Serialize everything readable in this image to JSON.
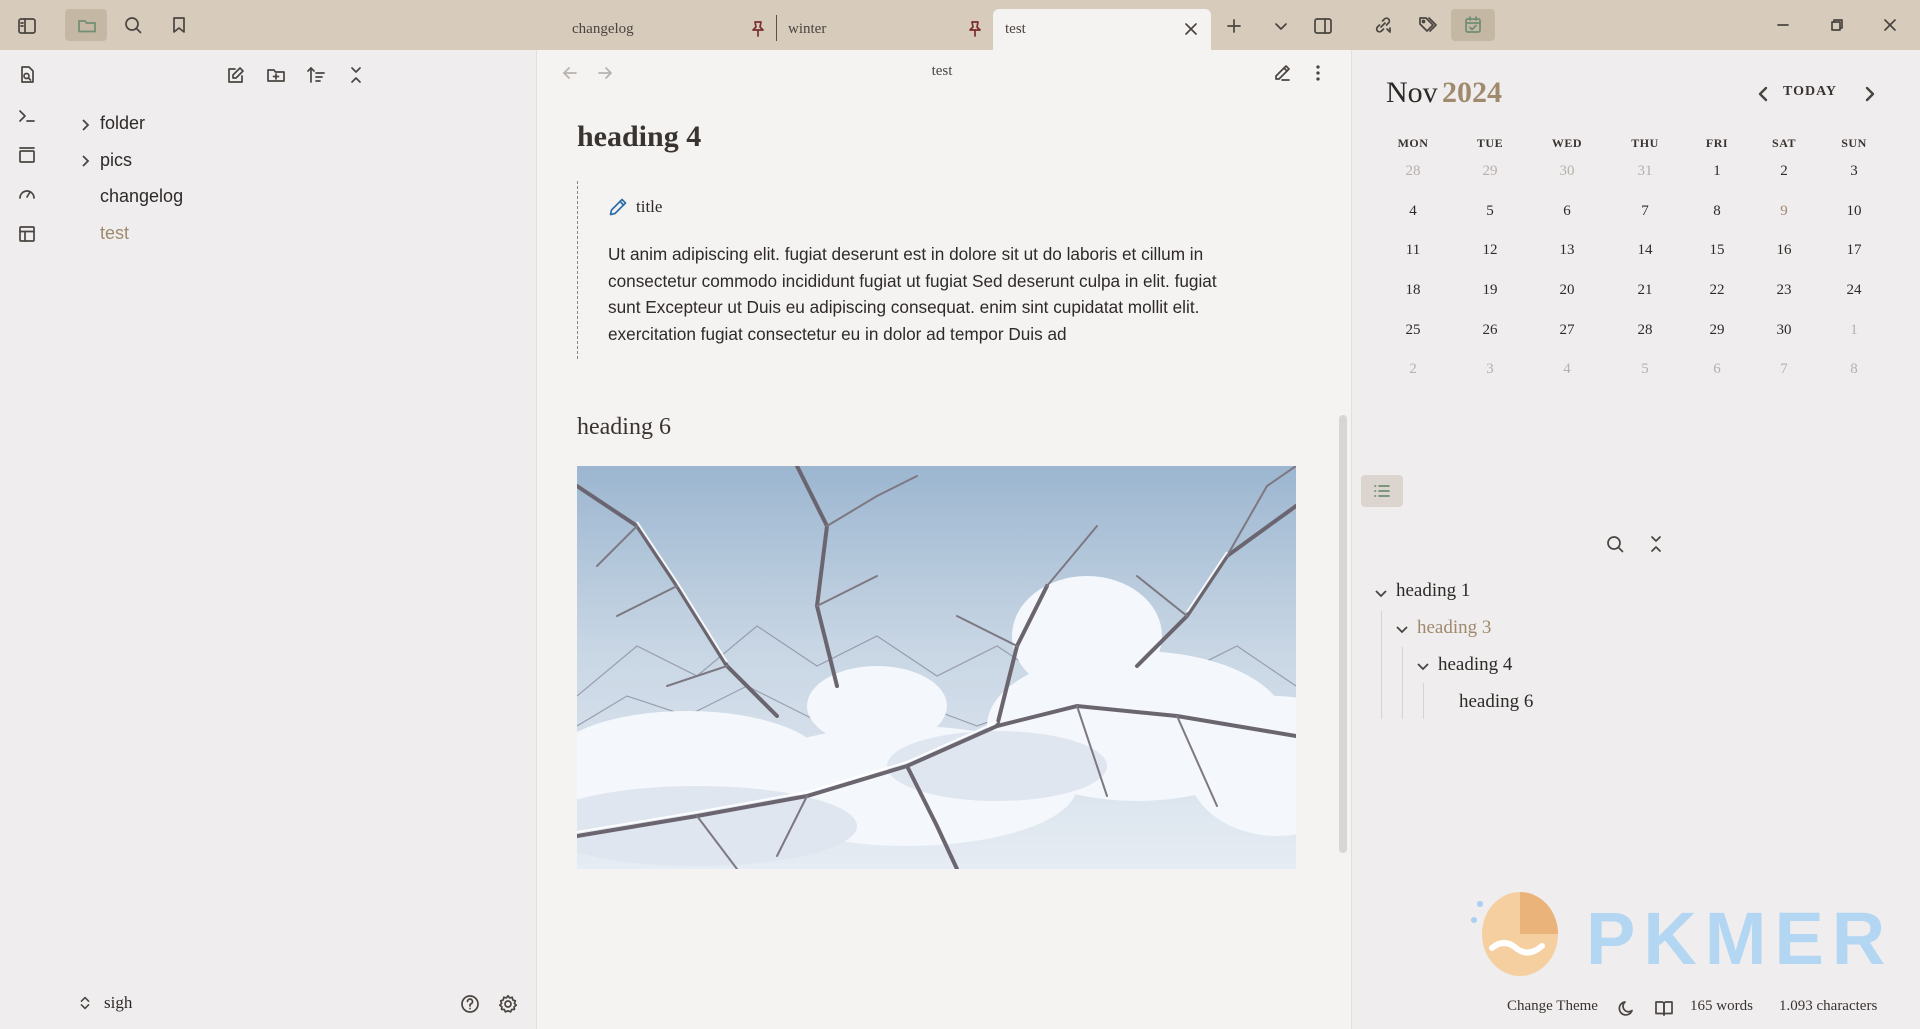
{
  "tabs": [
    {
      "label": "changelog",
      "pinned": true
    },
    {
      "label": "winter",
      "pinned": true
    },
    {
      "label": "test",
      "active": true
    }
  ],
  "file_tree": [
    {
      "label": "folder",
      "type": "folder"
    },
    {
      "label": "pics",
      "type": "folder"
    },
    {
      "label": "changelog",
      "type": "file"
    },
    {
      "label": "test",
      "type": "file",
      "active": true
    }
  ],
  "vault": {
    "name": "sigh"
  },
  "editor": {
    "title": "test",
    "heading4": "heading 4",
    "callout_title": "title",
    "callout_lines": [
      "Ut anim adipiscing elit. fugiat deserunt est in dolore sit ut do laboris et cillum in",
      "consectetur commodo incididunt fugiat ut fugiat Sed deserunt culpa in elit. fugiat",
      "sunt Excepteur ut Duis eu adipiscing consequat. enim sint cupidatat mollit elit.",
      "exercitation fugiat consectetur eu in dolor ad tempor Duis ad"
    ],
    "heading6": "heading 6",
    "image_alt": "winter"
  },
  "calendar": {
    "month": "Nov",
    "year": "2024",
    "today_label": "TODAY",
    "weekdays": [
      "MON",
      "TUE",
      "WED",
      "THU",
      "FRI",
      "SAT",
      "SUN"
    ],
    "weeks": [
      [
        "28",
        "29",
        "30",
        "31",
        "1",
        "2",
        "3"
      ],
      [
        "4",
        "5",
        "6",
        "7",
        "8",
        "9",
        "10"
      ],
      [
        "11",
        "12",
        "13",
        "14",
        "15",
        "16",
        "17"
      ],
      [
        "18",
        "19",
        "20",
        "21",
        "22",
        "23",
        "24"
      ],
      [
        "25",
        "26",
        "27",
        "28",
        "29",
        "30",
        "1"
      ],
      [
        "2",
        "3",
        "4",
        "5",
        "6",
        "7",
        "8"
      ]
    ]
  },
  "outline": [
    {
      "label": "heading 1",
      "level": 1
    },
    {
      "label": "heading 3",
      "level": 2,
      "highlight": true
    },
    {
      "label": "heading 4",
      "level": 3
    },
    {
      "label": "heading 6",
      "level": 4
    }
  ],
  "statusbar": {
    "change_theme": "Change Theme",
    "words": "165 words",
    "characters": "1.093 characters"
  },
  "watermark": {
    "text": "PKMER"
  },
  "colors": {
    "titlebar": "#d7cbbb",
    "accent_brown": "#a08a6e",
    "callout_icon": "#2f6ea8"
  }
}
